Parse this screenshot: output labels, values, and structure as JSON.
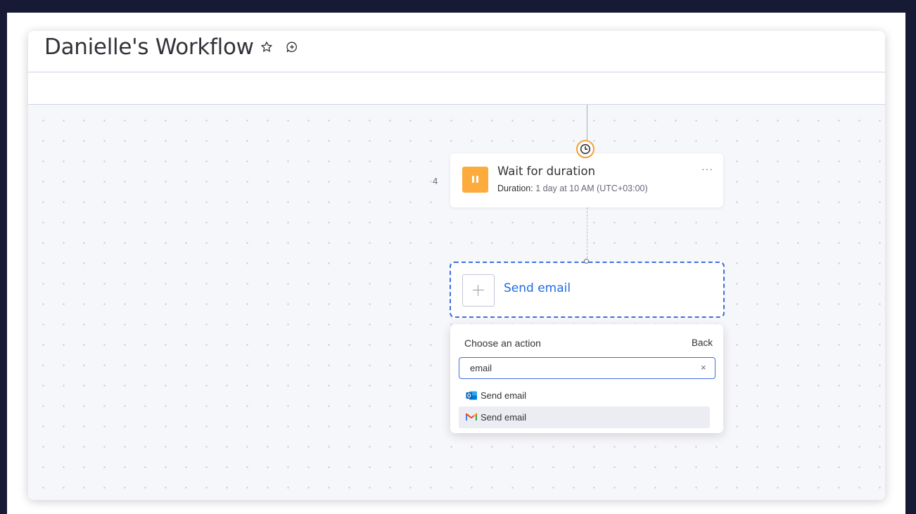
{
  "header": {
    "title": "Danielle's Workflow"
  },
  "icons": {
    "favorite": "star-outline-icon",
    "comment": "chat-plus-icon",
    "timer": "clock-icon",
    "wait": "pause-icon",
    "add": "plus-icon",
    "outlook": "outlook-icon",
    "gmail": "gmail-icon"
  },
  "colors": {
    "accent_blue": "#3c6fe0",
    "wait_orange": "#fdab3d",
    "timer_ring": "#f0a336"
  },
  "steps": [
    {
      "number": "4",
      "title": "Wait for duration",
      "duration_label": "Duration:",
      "duration_value": "1 day at 10 AM (UTC+03:00)",
      "menu": "···"
    }
  ],
  "pending_action": {
    "label": "Send email"
  },
  "action_picker": {
    "title": "Choose an action",
    "back_label": "Back",
    "search_value": "email",
    "clear": "×",
    "results": [
      {
        "label": "Send email",
        "icon": "outlook-icon"
      },
      {
        "label": "Send email",
        "icon": "gmail-icon"
      }
    ]
  }
}
